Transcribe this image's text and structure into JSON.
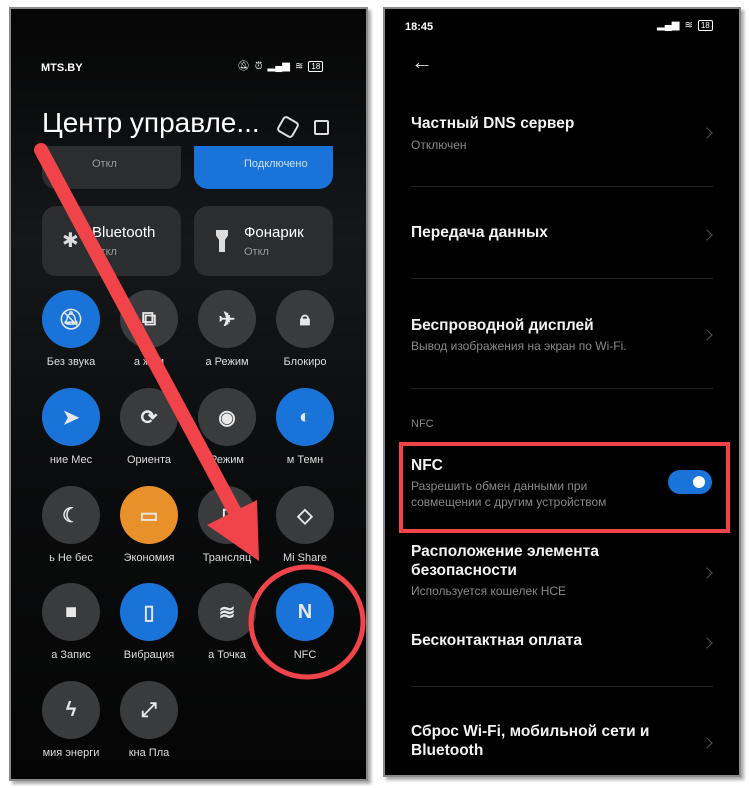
{
  "left": {
    "status": {
      "carrier": "MTS.BY",
      "battery": "18"
    },
    "title": "Центр управле...",
    "tiles": [
      {
        "title": "",
        "sub": "Откл"
      },
      {
        "title": "",
        "sub": "Подключено"
      },
      {
        "title": "Bluetooth",
        "sub": "Откл"
      },
      {
        "title": "Фонарик",
        "sub": "Откл"
      }
    ],
    "toggles": [
      {
        "label": "Без звука",
        "icon": "bell-off-icon",
        "state": "on"
      },
      {
        "label": "а   жим",
        "icon": "screenshot-icon",
        "state": "off"
      },
      {
        "label": "а  Режим",
        "icon": "airplane-icon",
        "state": "off"
      },
      {
        "label": "Блокиро",
        "icon": "lock-icon",
        "state": "off"
      },
      {
        "label": "ние   Мес",
        "icon": "location-icon",
        "state": "on"
      },
      {
        "label": "Ориента",
        "icon": "rotation-lock-icon",
        "state": "off"
      },
      {
        "label": "Режим",
        "icon": "eye-icon",
        "state": "off"
      },
      {
        "label": "м   Темн",
        "icon": "dark-mode-icon",
        "state": "on"
      },
      {
        "label": "ь   Не бес",
        "icon": "moon-icon",
        "state": "off"
      },
      {
        "label": "Экономия",
        "icon": "battery-saver-icon",
        "state": "orange"
      },
      {
        "label": "Трансляц",
        "icon": "cast-icon",
        "state": "off"
      },
      {
        "label": "Mi Share",
        "icon": "mi-share-icon",
        "state": "off"
      },
      {
        "label": "а   Запис",
        "icon": "video-icon",
        "state": "off"
      },
      {
        "label": "Вибрация",
        "icon": "vibrate-icon",
        "state": "on"
      },
      {
        "label": "а   Точка",
        "icon": "hotspot-icon",
        "state": "off"
      },
      {
        "label": "NFC",
        "icon": "nfc-icon",
        "state": "on"
      },
      {
        "label": "мия энерги",
        "icon": "lightning-icon",
        "state": "off"
      },
      {
        "label": "кна   Пла",
        "icon": "float-window-icon",
        "state": "off"
      }
    ]
  },
  "right": {
    "status": {
      "time": "18:45",
      "battery": "18"
    },
    "items": [
      {
        "title": "Частный DNS сервер",
        "sub": "Отключен"
      },
      {
        "title": "Передача данных"
      },
      {
        "title": "Беспроводной дисплей",
        "sub": "Вывод изображения на экран по Wi-Fi."
      }
    ],
    "section": "NFC",
    "nfc": {
      "title": "NFC",
      "sub1": "Разрешить обмен данными при",
      "sub2": "совмещении с другим устройством",
      "enabled": true
    },
    "items2": [
      {
        "title1": "Расположение элемента",
        "title2": "безопасности",
        "sub": "Используется кошелек HCE"
      },
      {
        "title": "Бесконтактная оплата"
      },
      {
        "title1": "Сброс Wi-Fi, мобильной сети и",
        "title2": "Bluetooth"
      }
    ]
  },
  "colors": {
    "accent": "#1a73d9",
    "annotation": "#f0434a",
    "orange": "#e8912a"
  }
}
